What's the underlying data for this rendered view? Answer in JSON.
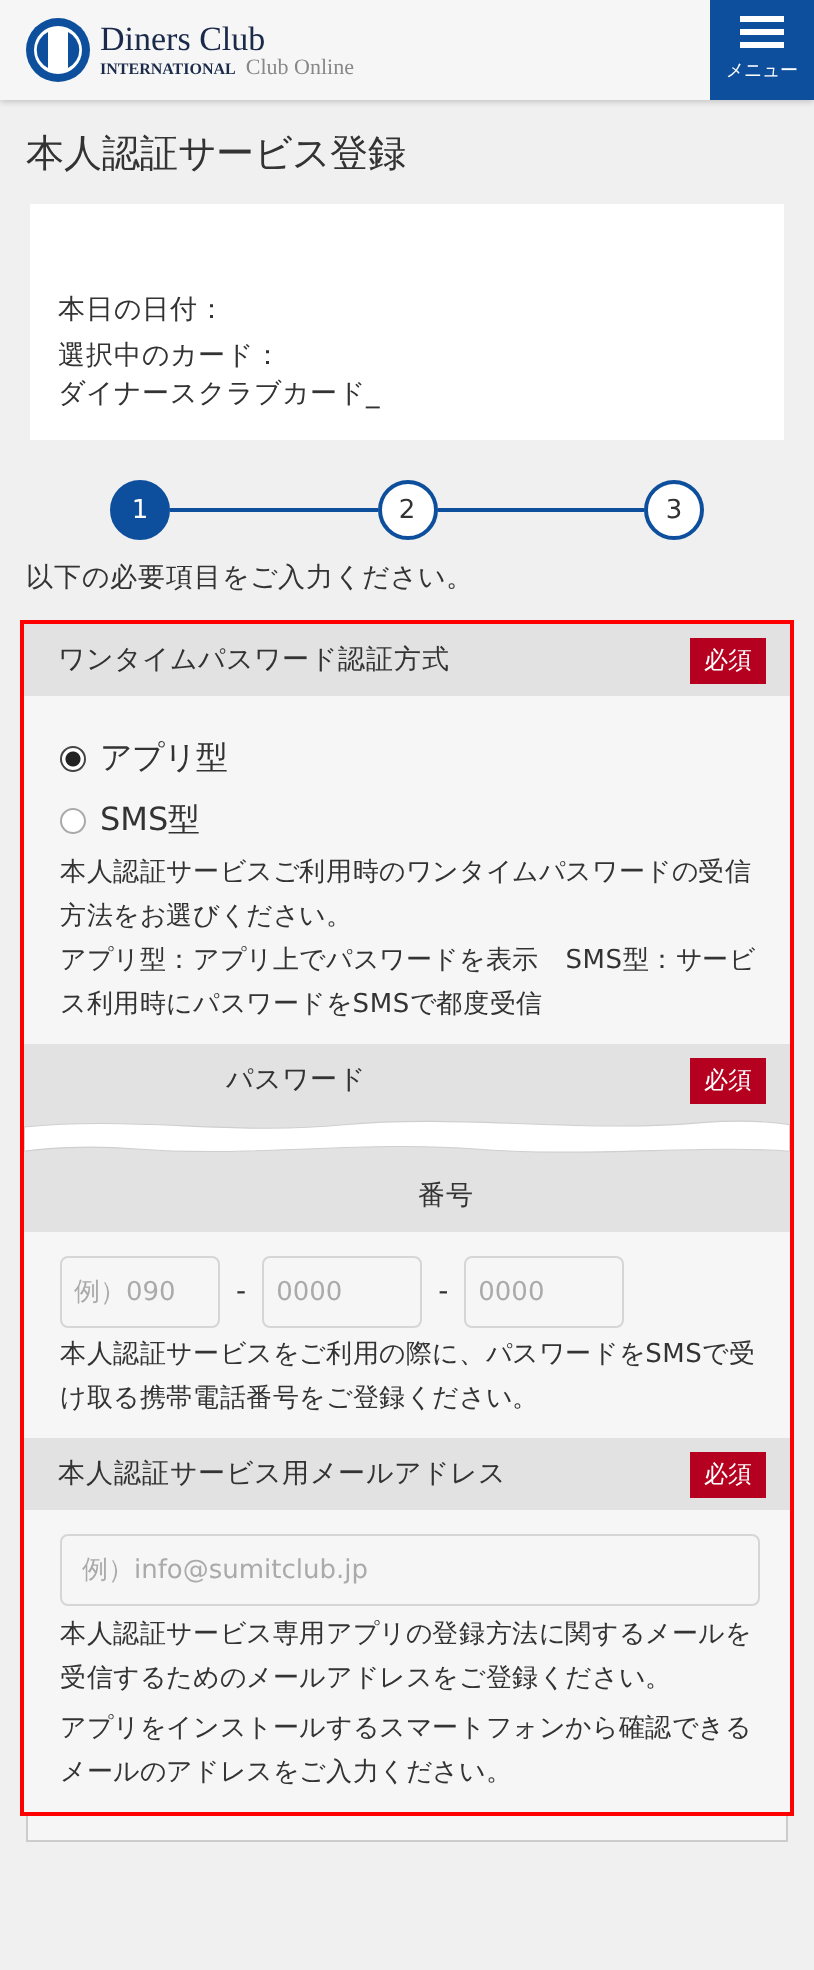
{
  "header": {
    "logo_title": "Diners Club",
    "logo_subtitle": "INTERNATIONAL",
    "logo_service": "Club Online",
    "menu_label": "メニュー"
  },
  "page_title": "本人認証サービス登録",
  "info_lines": [
    "本日の日付：",
    "選択中のカード：",
    "ダイナースクラブカード_"
  ],
  "steps": [
    {
      "label": "1",
      "selected": true
    },
    {
      "label": "2",
      "selected": false
    },
    {
      "label": "3",
      "selected": false
    }
  ],
  "instruction": "以下の必要項目をご入力ください。",
  "sections": [
    {
      "kind": "radio",
      "title": "ワンタイムパスワード認証方式",
      "badge": "必須",
      "options": [
        {
          "label": "アプリ型",
          "selected": true
        },
        {
          "label": "SMS型",
          "selected": false
        }
      ],
      "notes": [
        "本人認証サービスご利用時のワンタイムパスワードの受信方法をお選びください。",
        "アプリ型：アプリ上でパスワードを表示　SMS型：サービス利用時にパスワードをSMSで都度受信"
      ]
    },
    {
      "kind": "cut",
      "title": "パスワード",
      "badge": "必須"
    },
    {
      "kind": "phone",
      "title": "番号",
      "placeholders": [
        "例）090",
        "0000",
        "0000"
      ],
      "separators": [
        "-",
        "-"
      ],
      "notes": [
        "本人認証サービスをご利用の際に、パスワードをSMSで受け取る携帯電話番号をご登録ください。"
      ]
    },
    {
      "kind": "email",
      "title": "本人認証サービス用メールアドレス",
      "badge": "必須",
      "placeholder": "例）info@sumitclub.jp",
      "notes": [
        "本人認証サービス専用アプリの登録方法に関するメールを受信するためのメールアドレスをご登録ください。",
        "アプリをインストールするスマートフォンから確認できるメールのアドレスをご入力ください。"
      ]
    }
  ]
}
